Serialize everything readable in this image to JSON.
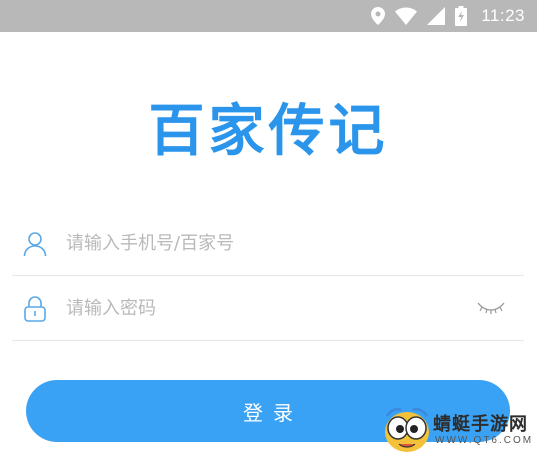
{
  "status_bar": {
    "time": "11:23",
    "icons": [
      "location-icon",
      "wifi-icon",
      "signal-icon",
      "battery-charging-icon"
    ]
  },
  "app": {
    "logo_text": "百家传记",
    "brand_color": "#2b95ec"
  },
  "form": {
    "phone_placeholder": "请输入手机号/百家号",
    "password_placeholder": "请输入密码",
    "login_label": "登录"
  },
  "watermark": {
    "title": "蜻蜓手游网",
    "url": "WWW.QT6.COM"
  }
}
